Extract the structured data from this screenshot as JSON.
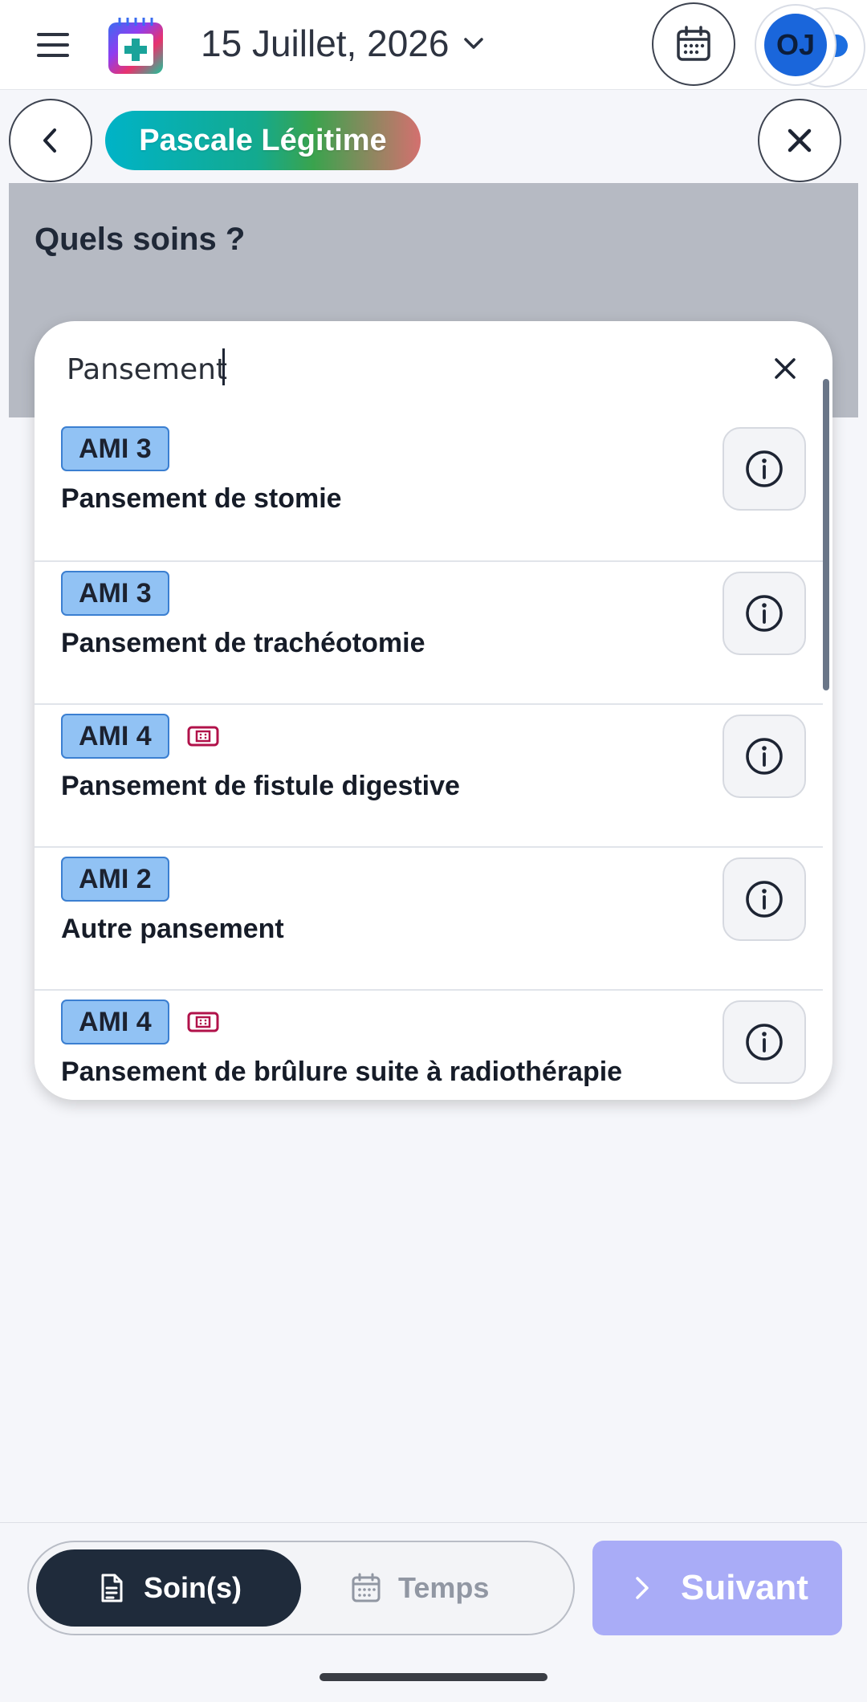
{
  "header": {
    "date": "15 Juillet, 2026",
    "avatar_initials": "OJ",
    "icons": {
      "menu": "menu-icon",
      "logo": "app-logo",
      "date_dropdown": "chevron-down-icon",
      "calendar": "calendar-icon"
    }
  },
  "patient": {
    "name": "Pascale Légitime",
    "back_icon": "chevron-left-icon",
    "close_icon": "close-icon"
  },
  "question": {
    "title": "Quels soins ?"
  },
  "search": {
    "value": "Pansement",
    "clear_icon": "close-icon",
    "results": [
      {
        "code": "AMI 3",
        "label": "Pansement de stomie",
        "bandage": false
      },
      {
        "code": "AMI 3",
        "label": "Pansement de trachéotomie",
        "bandage": false
      },
      {
        "code": "AMI 4",
        "label": "Pansement de fistule digestive",
        "bandage": true
      },
      {
        "code": "AMI 2",
        "label": "Autre pansement",
        "bandage": false
      },
      {
        "code": "AMI 4",
        "label": "Pansement de brûlure suite à radiothérapie",
        "bandage": true
      }
    ]
  },
  "footer": {
    "soins_label": "Soin(s)",
    "temps_label": "Temps",
    "next_label": "Suivant"
  },
  "colors": {
    "badge_fill": "#91c2f4",
    "badge_border": "#3b7fd1",
    "bandage": "#b1124a",
    "next_button": "#a9acf7",
    "active_toggle": "#1f2b3b"
  }
}
